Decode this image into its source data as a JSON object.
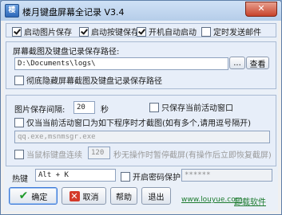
{
  "window": {
    "title": "楼月键盘屏幕全记录 V3.4",
    "app_icon": "楼",
    "close_glyph": "✕"
  },
  "options": {
    "enable_screenshot": {
      "label": "启动图片保存",
      "checked": true
    },
    "enable_keylog": {
      "label": "启动按键保存",
      "checked": true
    },
    "auto_start": {
      "label": "开机自动启动",
      "checked": true
    },
    "send_email": {
      "label": "定时发送邮件",
      "checked": false
    }
  },
  "save_path": {
    "label": "屏幕截图及键盘记录保存路径:",
    "value": "D:\\Documents\\logs\\",
    "browse_label": "...",
    "view_label": "查看",
    "hide_label": "彻底隐藏屏幕截图及键盘记录保存路径",
    "hide_checked": false
  },
  "screenshot": {
    "interval_label": "图片保存间隔:",
    "interval_value": "20",
    "interval_unit": "秒",
    "only_active_label": "只保存当前活动窗口",
    "only_active_checked": false,
    "program_only_label": "仅当当前活动窗口为如下程序时才截图(如有多个,请用逗号隔开)",
    "program_only_checked": false,
    "program_list_placeholder": "qq.exe,msnmsgr.exe",
    "idle_label_prefix": "当鼠标键盘连续",
    "idle_value": "120",
    "idle_label_suffix": "秒无操作时暂停截屏(有操作后立即恢复截屏)",
    "idle_checked": false
  },
  "hotkey": {
    "label": "热键",
    "value": "Alt + K",
    "password_label": "开启密码保护",
    "password_checked": false,
    "password_value": "******"
  },
  "buttons": {
    "ok": "确定",
    "cancel": "取消",
    "help": "帮助",
    "exit": "退出"
  },
  "links": {
    "website": "www.louyue.com",
    "uninstall": "卸载软件"
  }
}
